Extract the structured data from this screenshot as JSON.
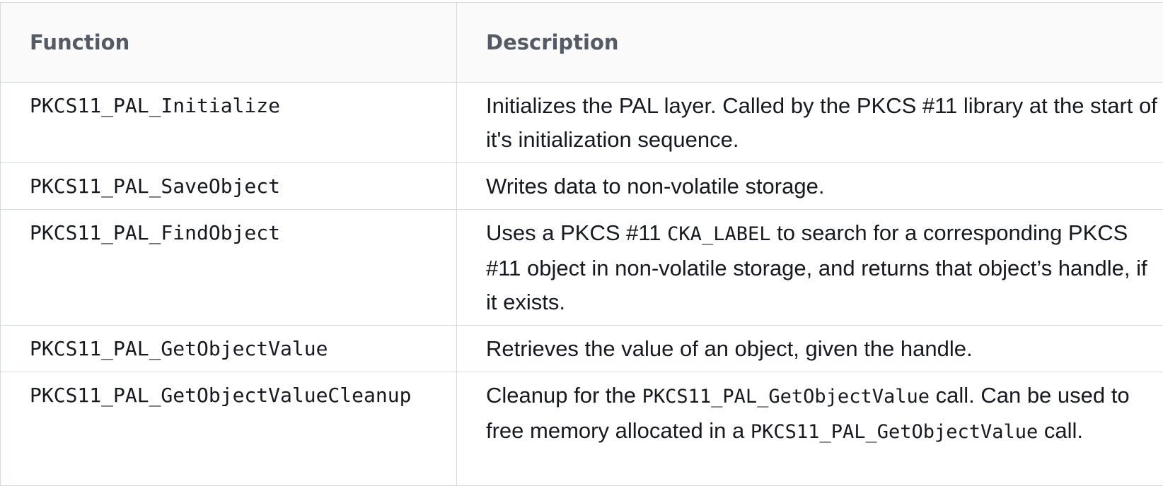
{
  "table": {
    "headers": [
      "Function",
      "Description"
    ],
    "rows": [
      {
        "function": "PKCS11_PAL_Initialize",
        "description": {
          "text1": "Initializes the PAL layer. Called by the PKCS #11 library at the start of it's initialization sequence."
        }
      },
      {
        "function": "PKCS11_PAL_SaveObject",
        "description": {
          "text1": "Writes data to non-volatile storage."
        }
      },
      {
        "function": "PKCS11_PAL_FindObject",
        "description": {
          "text1": "Uses a PKCS #11 ",
          "code1": "CKA_LABEL",
          "text2": " to search for a corresponding PKCS #11 object in non-volatile storage, and returns that object’s handle, if it exists."
        }
      },
      {
        "function": "PKCS11_PAL_GetObjectValue",
        "description": {
          "text1": "Retrieves the value of an object, given the handle."
        }
      },
      {
        "function": "PKCS11_PAL_GetObjectValueCleanup",
        "description": {
          "text1": "Cleanup for the ",
          "code1": "PKCS11_PAL_GetObjectValue",
          "text2": " call. Can be used to free memory allocated in a ",
          "code2": "PKCS11_PAL_GetObjectValue",
          "text3": " call."
        }
      }
    ]
  }
}
